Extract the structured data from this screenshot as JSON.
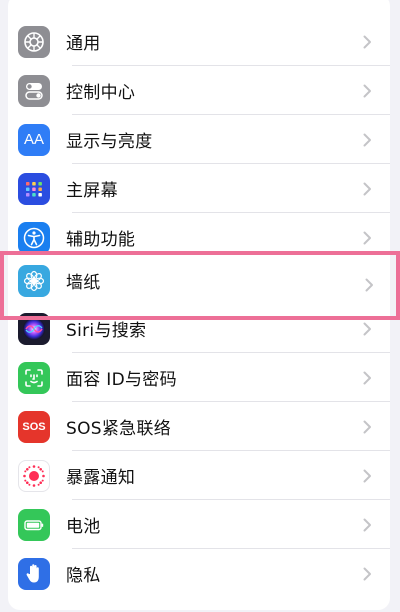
{
  "settings": {
    "items": [
      {
        "label": "通用",
        "icon": "gear-icon",
        "icon_color": "#8e8e93"
      },
      {
        "label": "控制中心",
        "icon": "toggles-icon",
        "icon_color": "#8e8e93"
      },
      {
        "label": "显示与亮度",
        "icon": "text-size-icon",
        "icon_color": "#2f7df6",
        "icon_text": "AA"
      },
      {
        "label": "主屏幕",
        "icon": "home-grid-icon",
        "icon_color": "#2b4de0"
      },
      {
        "label": "辅助功能",
        "icon": "accessibility-icon",
        "icon_color": "#1a7ff0"
      },
      {
        "label": "墙纸",
        "icon": "flower-icon",
        "icon_color": "#38a8e0"
      },
      {
        "label": "Siri与搜索",
        "icon": "siri-icon",
        "icon_color": "#1b1b2e"
      },
      {
        "label": "面容 ID与密码",
        "icon": "face-id-icon",
        "icon_color": "#34c759"
      },
      {
        "label": "SOS紧急联络",
        "icon": "sos-icon",
        "icon_color": "#e5352b",
        "icon_text": "SOS"
      },
      {
        "label": "暴露通知",
        "icon": "exposure-icon",
        "icon_color": "#ffffff"
      },
      {
        "label": "电池",
        "icon": "battery-icon",
        "icon_color": "#34c759"
      },
      {
        "label": "隐私",
        "icon": "hand-icon",
        "icon_color": "#2f6fe6"
      }
    ]
  },
  "highlight_color": "#ed6f97"
}
